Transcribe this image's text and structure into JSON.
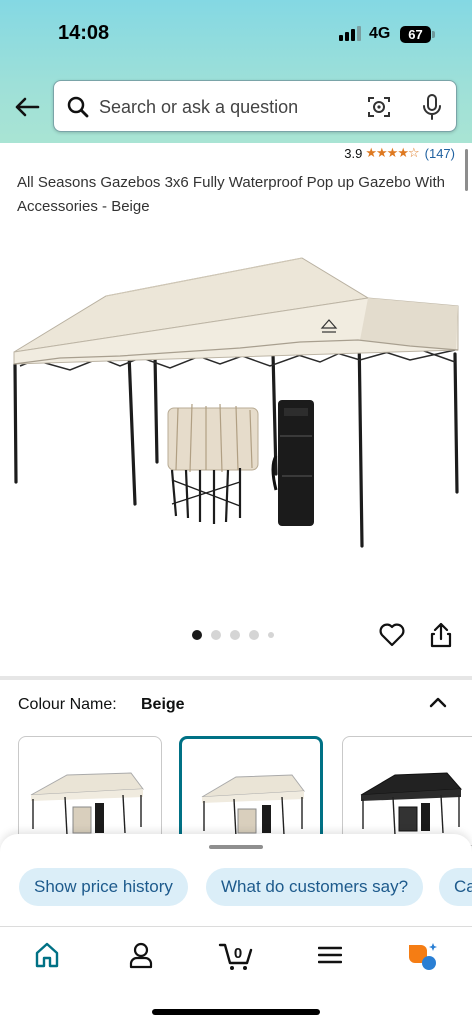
{
  "status_bar": {
    "time": "14:08",
    "network": "4G",
    "battery": "67"
  },
  "search": {
    "placeholder": "Search or ask a question"
  },
  "product": {
    "rating": "3.9",
    "stars": "★★★★☆",
    "review_count": "(147)",
    "title": "All Seasons Gazebos 3x6 Fully Waterproof Pop up Gazebo With Accessories - Beige",
    "image_index": 0,
    "image_count": 5
  },
  "colour": {
    "label": "Colour Name:",
    "value": "Beige"
  },
  "swatches": [
    {
      "name": "Beige",
      "selected": false
    },
    {
      "name": "Beige",
      "selected": true
    },
    {
      "name": "Black",
      "selected": false
    }
  ],
  "suggestions": [
    "Show price history",
    "What do customers say?",
    "Ca"
  ],
  "tabbar": {
    "cart_count": "0"
  },
  "colors": {
    "accent": "#007185",
    "star": "#de7921",
    "link": "#2162a1",
    "chip_bg": "#dbeef8",
    "chip_text": "#1d5a8c"
  },
  "icons": [
    "back-arrow-icon",
    "search-icon",
    "camera-lens-icon",
    "microphone-icon",
    "heart-icon",
    "share-icon",
    "chevron-up-icon",
    "home-icon",
    "account-icon",
    "cart-icon",
    "menu-icon",
    "rufus-assistant-icon"
  ]
}
